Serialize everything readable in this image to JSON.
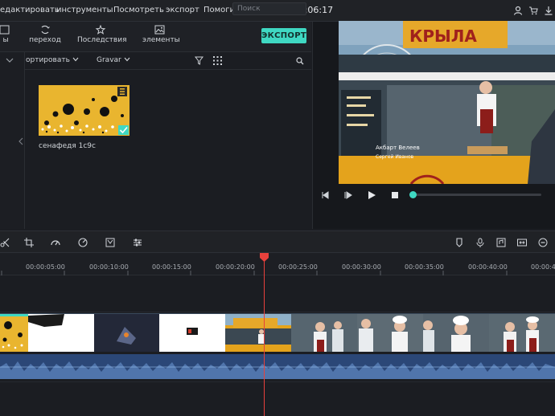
{
  "menu": {
    "items": [
      "едактировать",
      "инструменты",
      "Посмотреть",
      "экспорт",
      "Помогите"
    ],
    "timecode": "00:23:06:17"
  },
  "top_icons": [
    "user-icon",
    "cart-icon",
    "download-icon"
  ],
  "toolbar": {
    "tabs": [
      {
        "label": "ы",
        "icon": "media-icon"
      },
      {
        "label": "переход",
        "icon": "transition-icon"
      },
      {
        "label": "Последствия",
        "icon": "effects-icon"
      },
      {
        "label": "элементы",
        "icon": "elements-icon"
      }
    ],
    "export_label": "ЭКСПОРТ"
  },
  "media": {
    "sort_dropdown": "ортировать",
    "view_dropdown": "Gravar",
    "search_placeholder": "Поиск",
    "clip_name": "сенафедя 1с9с"
  },
  "preview": {
    "lower_third_line1": "Акбарт Велеев",
    "lower_third_line2": "Сергей Иванов",
    "sign_text": "КРЫЛА",
    "progress": 0.03
  },
  "timeline": {
    "ticks": [
      "00:00:05:00",
      "00:00:10:00",
      "00:00:15:00",
      "00:00:20:00",
      "00:00:25:00",
      "00:00:30:00",
      "00:00:35:00",
      "00:00:40:00",
      "00:00:4"
    ],
    "playhead_time": "00:00:20:12"
  },
  "colors": {
    "accent": "#3fd8c2",
    "playhead": "#e8413c",
    "audio": "#2d4a7a",
    "clip_yellow": "#e9b52f"
  }
}
